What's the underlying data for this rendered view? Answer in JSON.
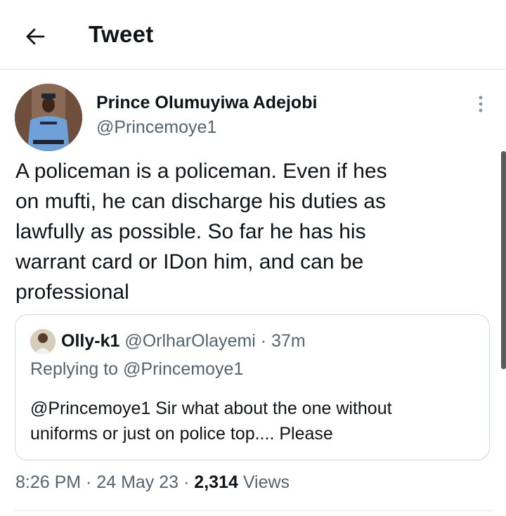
{
  "header": {
    "title": "Tweet",
    "back_icon": "arrow-left-icon"
  },
  "tweet": {
    "author": {
      "name": "Prince Olumuyiwa Adejobi",
      "handle": "@Princemoye1",
      "avatar": "police-officer-avatar"
    },
    "text": "A policeman is a policeman. Even if hes\non mufti, he can discharge his duties as\nlawfully as possible. So far he has his\nwarrant card or IDon him, and can be\nprofessional",
    "more_icon": "more-vertical-icon",
    "quote": {
      "name": "Olly-k1",
      "handle": "@OrlharOlayemi",
      "sep": " · ",
      "time": "37m",
      "replying": "Replying to @Princemoye1",
      "text": "@Princemoye1  Sir what about the one without\nuniforms or just on police top.... Please"
    },
    "meta": {
      "time": "8:26 PM",
      "sep": " · ",
      "date": "24 May 23",
      "views_count": "2,314",
      "views_label": "Views"
    }
  },
  "colors": {
    "text": "#0f1419",
    "secondary": "#536471",
    "border": "#cfd9de"
  }
}
